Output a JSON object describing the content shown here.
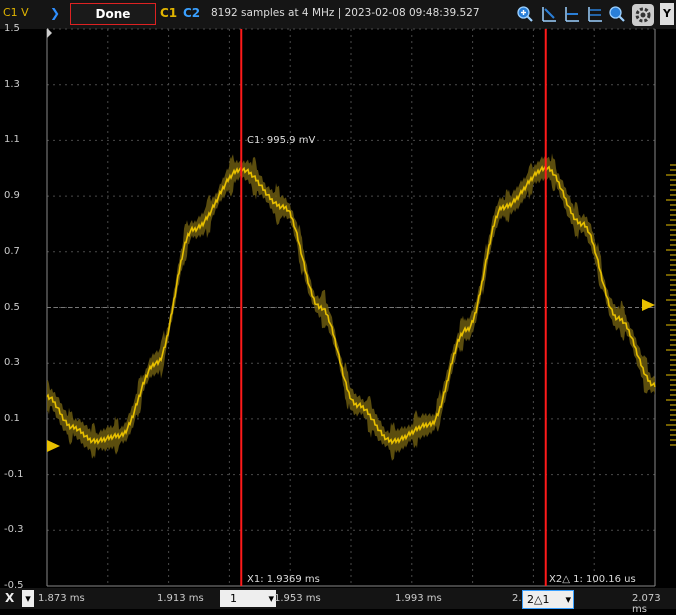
{
  "toolbar": {
    "channel_scale": "C1 V",
    "done_label": "Done",
    "c1_label": "C1",
    "c2_label": "C2",
    "status_text": "8192 samples at 4 MHz | 2023-02-08 09:48:39.527",
    "y_button": "Y"
  },
  "y_axis": {
    "ticks": [
      "1.5",
      "1.3",
      "1.1",
      "0.9",
      "0.7",
      "0.5",
      "0.3",
      "0.1",
      "-0.1",
      "-0.3",
      "-0.5"
    ]
  },
  "x_axis": {
    "x_button": "X",
    "ticks": [
      {
        "label": "1.873 ms"
      },
      {
        "label": "1.913 ms"
      },
      {
        "label": "1.953 ms"
      },
      {
        "label": "1.993 ms"
      },
      {
        "label": "2."
      },
      {
        "label": "2.073 ms"
      }
    ],
    "dropdown_1": "1",
    "dropdown_2": "2△1"
  },
  "cursors": {
    "c1_readout": "C1: 995.9 mV",
    "x1_readout": "X1: 1.9369 ms",
    "x2_readout": "X2△ 1: 100.16 us"
  },
  "colors": {
    "trace": "#e8c000",
    "envelope": "#6b5a10",
    "cursor": "#ff1a1a",
    "grid": "#555555"
  },
  "chart_data": {
    "type": "line",
    "title": "",
    "xlabel": "",
    "ylabel": "C1 V",
    "xlim": [
      1.873,
      2.073
    ],
    "ylim": [
      -0.5,
      1.5
    ],
    "series": [
      {
        "x": [
          1.873,
          1.8814,
          1.8886,
          1.897,
          1.909,
          1.921,
          1.9369,
          1.951,
          1.963,
          1.975,
          1.9866,
          1.999,
          2.011,
          2.023,
          2.0373,
          2.049,
          2.061,
          2.073
        ],
        "values": [
          0.18,
          0.07,
          0.02,
          0.04,
          0.3,
          0.78,
          0.996,
          0.86,
          0.5,
          0.15,
          0.02,
          0.08,
          0.42,
          0.86,
          1.0,
          0.8,
          0.46,
          0.22
        ]
      }
    ],
    "cursors": {
      "x1": 1.9369,
      "x2_minus_x1_us": 100.16,
      "c1_mV": 995.9
    }
  }
}
